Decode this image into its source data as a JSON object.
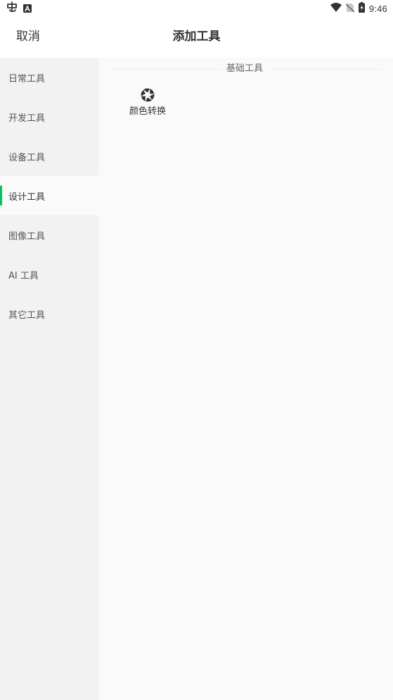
{
  "status_bar": {
    "time": "9:46",
    "left_icons": [
      "app-notification-icon",
      "keyboard-a-icon"
    ],
    "right_icons": [
      "wifi-icon",
      "no-sim-icon",
      "battery-charging-icon"
    ]
  },
  "header": {
    "cancel_label": "取消",
    "title": "添加工具"
  },
  "sidebar": {
    "items": [
      {
        "label": "日常工具",
        "active": false
      },
      {
        "label": "开发工具",
        "active": false
      },
      {
        "label": "设备工具",
        "active": false
      },
      {
        "label": "设计工具",
        "active": true
      },
      {
        "label": "图像工具",
        "active": false
      },
      {
        "label": "AI 工具",
        "active": false
      },
      {
        "label": "其它工具",
        "active": false
      }
    ]
  },
  "content": {
    "section_title": "基础工具",
    "tools": [
      {
        "label": "颜色转换",
        "icon": "aperture-icon"
      }
    ]
  },
  "colors": {
    "accent": "#07c160",
    "background": "#fafafa",
    "sidebar_background": "#f2f2f2",
    "header_background": "#ffffff",
    "text_primary": "#333333",
    "text_secondary": "#555555"
  }
}
